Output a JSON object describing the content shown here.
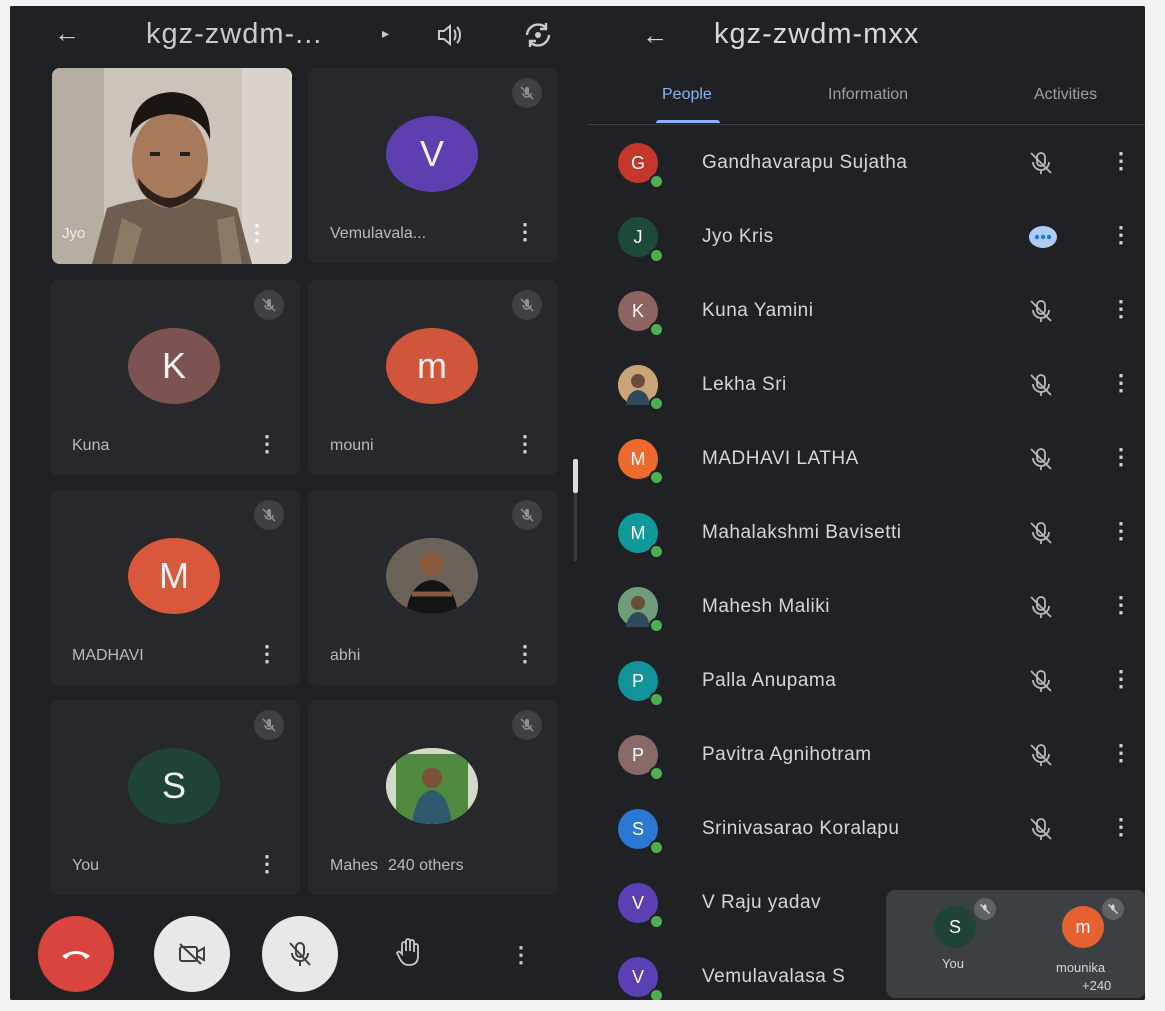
{
  "left_header": {
    "back_icon": "arrow-left-icon",
    "meeting_code": "kgz-zwdm-...",
    "caret": "▸",
    "speaker_icon": "speaker-icon",
    "switch_camera_icon": "switch-camera-icon"
  },
  "tiles": [
    {
      "name": "Jyo",
      "type": "video"
    },
    {
      "name": "Vemulavala...",
      "initial": "V",
      "color": "#5e3fb0",
      "muted": true
    },
    {
      "name": "Kuna",
      "initial": "K",
      "color": "#7d5352",
      "muted": true
    },
    {
      "name": "mouni",
      "initial": "m",
      "color": "#d1553b",
      "muted": true
    },
    {
      "name": "MADHAVI",
      "initial": "M",
      "color": "#d9583c",
      "muted": true
    },
    {
      "name": "abhi",
      "type": "photo",
      "muted": true
    },
    {
      "name": "You",
      "initial": "S",
      "color": "#1f4437",
      "muted": true
    },
    {
      "name": "Mahes",
      "type": "photo",
      "extra": "240 others",
      "muted": true
    }
  ],
  "controls": {
    "end_call_icon": "phone-hangup-icon",
    "camera_icon": "camera-off-icon",
    "mic_icon": "mic-off-icon",
    "hand_icon": "raise-hand-icon",
    "more_icon": "more-vertical-icon"
  },
  "right_header": {
    "back_icon": "arrow-left-icon",
    "meeting_code": "kgz-zwdm-mxx"
  },
  "tabs": [
    {
      "label": "People",
      "active": true
    },
    {
      "label": "Information",
      "active": false
    },
    {
      "label": "Activities",
      "active": false
    }
  ],
  "people": [
    {
      "name": "Gandhavarapu Sujatha",
      "initial": "G",
      "color": "#c5372c",
      "status": "muted"
    },
    {
      "name": "Jyo Kris",
      "initial": "J",
      "color": "#1d4a39",
      "status": "speaking"
    },
    {
      "name": "Kuna Yamini",
      "initial": "K",
      "color": "#8d6460",
      "status": "muted"
    },
    {
      "name": "Lekha Sri",
      "initial": "",
      "color": "#c8a476",
      "status": "muted",
      "photo": true
    },
    {
      "name": "MADHAVI LATHA",
      "initial": "M",
      "color": "#ee6a2c",
      "status": "muted"
    },
    {
      "name": "Mahalakshmi Bavisetti",
      "initial": "M",
      "color": "#0f9a9a",
      "status": "muted"
    },
    {
      "name": "Mahesh Maliki",
      "initial": "",
      "color": "#6f9c7a",
      "status": "muted",
      "photo": true
    },
    {
      "name": "Palla Anupama",
      "initial": "P",
      "color": "#12939a",
      "status": "muted"
    },
    {
      "name": "Pavitra Agnihotram",
      "initial": "P",
      "color": "#8a6a66",
      "status": "muted"
    },
    {
      "name": "Srinivasarao Koralapu",
      "initial": "S",
      "color": "#2b78d4",
      "status": "muted"
    },
    {
      "name": "V Raju yadav",
      "initial": "V",
      "color": "#5a3fb5",
      "status": "muted"
    },
    {
      "name": "Vemulavalasa S",
      "initial": "V",
      "color": "#5a3fb5",
      "status": "muted"
    }
  ],
  "mini_view": {
    "self": {
      "initial": "S",
      "label": "You",
      "color": "#1f4437"
    },
    "other": {
      "initial": "m",
      "label": "mounika",
      "color": "#e5612f"
    },
    "extra": "+240"
  }
}
